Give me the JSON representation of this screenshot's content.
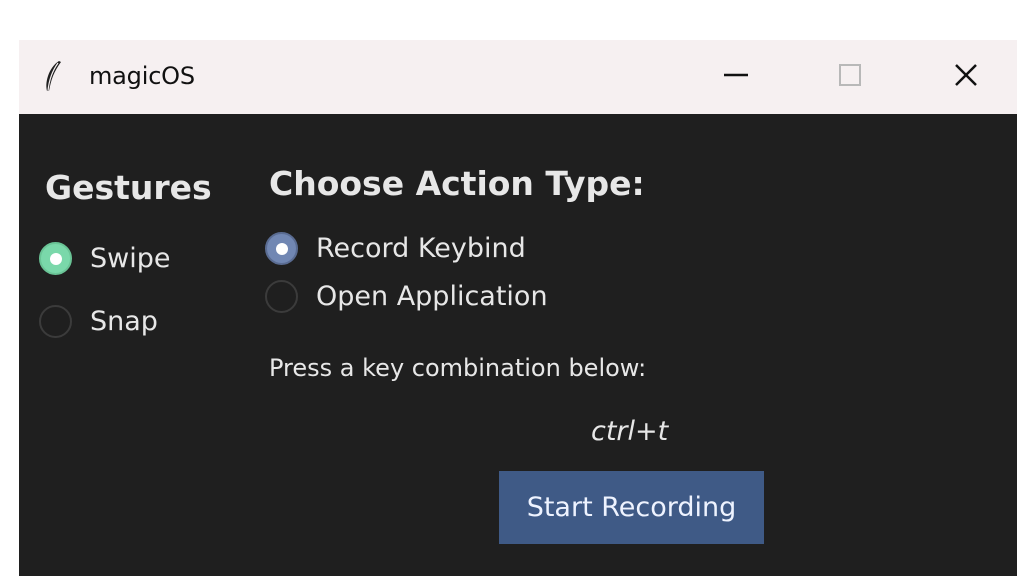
{
  "window": {
    "title": "magicOS",
    "icon": "feather-icon",
    "controls": {
      "minimize": "minimize-icon",
      "maximize": "maximize-icon",
      "close": "close-icon"
    }
  },
  "sidebar": {
    "title": "Gestures",
    "items": [
      {
        "label": "Swipe",
        "selected": true
      },
      {
        "label": "Snap",
        "selected": false
      }
    ],
    "accent_color": "#7ad8aa"
  },
  "main": {
    "title": "Choose Action Type:",
    "action_types": [
      {
        "label": "Record Keybind",
        "selected": true
      },
      {
        "label": "Open Application",
        "selected": false
      }
    ],
    "instruction": "Press a key combination below:",
    "current_keybind": "ctrl+t",
    "record_button_label": "Start Recording",
    "accent_color": "#3f5a86"
  },
  "colors": {
    "titlebar_bg": "#f6f0f1",
    "content_bg": "#1f1f1f",
    "text": "#e7e7e7"
  }
}
